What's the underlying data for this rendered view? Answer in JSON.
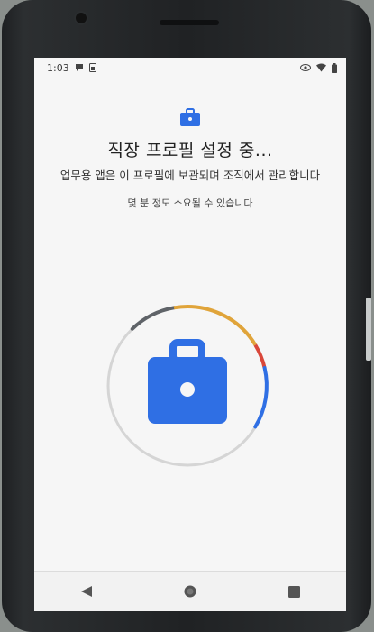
{
  "status_bar": {
    "time": "1:03",
    "icons_left": [
      "chat-bubble-icon",
      "sim-icon"
    ],
    "icons_right": [
      "eye-icon",
      "wifi-icon",
      "battery-icon"
    ]
  },
  "setup": {
    "title": "직장 프로필 설정 중...",
    "subtitle": "업무용 앱은 이 프로필에 보관되며 조직에서 관리합니다",
    "note": "몇 분 정도 소요될 수 있습니다"
  },
  "progress_icon": "briefcase-icon",
  "colors": {
    "accent": "#2f6fe4",
    "ring_track": "#d5d5d5",
    "ring_dark": "#5f6368",
    "ring_yellow": "#e0a43a",
    "ring_red": "#d9473a",
    "ring_blue": "#2f6fe4"
  },
  "nav": [
    "back-icon",
    "home-icon",
    "recents-icon"
  ]
}
